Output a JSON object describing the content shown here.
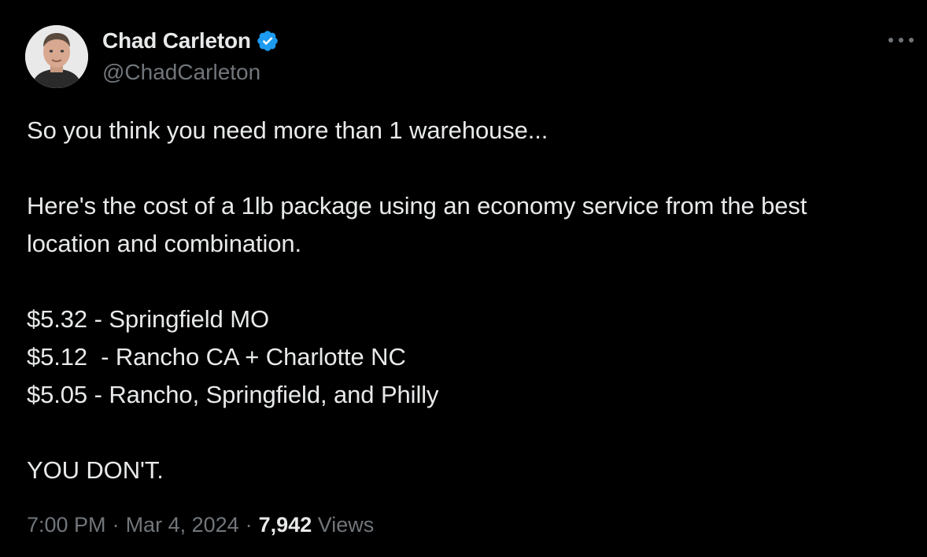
{
  "author": {
    "display_name": "Chad Carleton",
    "handle": "@ChadCarleton",
    "verified": true
  },
  "tweet": {
    "lines": [
      "So you think you need more than 1 warehouse...",
      "",
      "Here's the cost of a 1lb package using an economy service from the best",
      "location and combination.",
      "",
      "$5.32 - Springfield MO",
      "$5.12  - Rancho CA + Charlotte NC",
      "$5.05 - Rancho, Springfield, and Philly",
      "",
      "YOU DON'T."
    ]
  },
  "meta": {
    "time": "7:00 PM",
    "separator": "·",
    "date": "Mar 4, 2024",
    "views_count": "7,942",
    "views_label": "Views"
  },
  "colors": {
    "background": "#000000",
    "text": "#e7e9ea",
    "secondary": "#71767b",
    "verified_blue": "#1d9bf0"
  },
  "icons": {
    "verified": "verified-badge-icon",
    "more": "more-options-icon"
  }
}
